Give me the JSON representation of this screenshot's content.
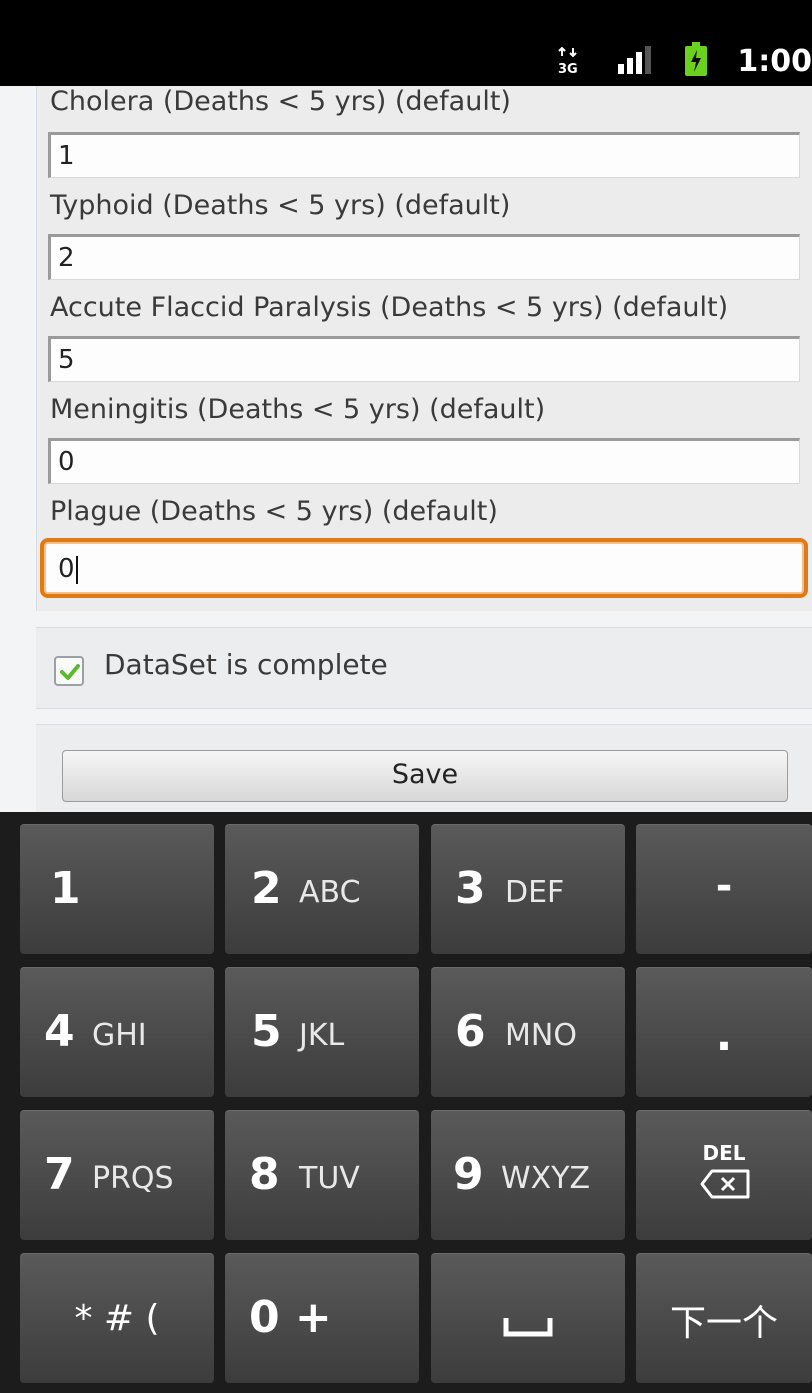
{
  "status_bar": {
    "network_type": "3G",
    "time": "1:00"
  },
  "form": {
    "fields": [
      {
        "label": "Cholera (Deaths < 5 yrs) (default)",
        "value": "1"
      },
      {
        "label": "Typhoid (Deaths < 5 yrs) (default)",
        "value": "2"
      },
      {
        "label": "Accute Flaccid Paralysis (Deaths < 5 yrs) (default)",
        "value": "5"
      },
      {
        "label": "Meningitis (Deaths < 5 yrs) (default)",
        "value": "0"
      },
      {
        "label": "Plague (Deaths < 5 yrs) (default)",
        "value": "0"
      }
    ],
    "complete_label": "DataSet is complete",
    "complete_checked": true,
    "save_label": "Save"
  },
  "keyboard": {
    "keys": [
      {
        "main": "1",
        "sub": ""
      },
      {
        "main": "2",
        "sub": "ABC"
      },
      {
        "main": "3",
        "sub": "DEF"
      },
      {
        "main": "-",
        "sub": ""
      },
      {
        "main": "4",
        "sub": "GHI"
      },
      {
        "main": "5",
        "sub": "JKL"
      },
      {
        "main": "6",
        "sub": "MNO"
      },
      {
        "main": ".",
        "sub": ""
      },
      {
        "main": "7",
        "sub": "PRQS"
      },
      {
        "main": "8",
        "sub": "TUV"
      },
      {
        "main": "9",
        "sub": "WXYZ"
      },
      {
        "main": "DEL",
        "sub": ""
      },
      {
        "main": "* # (",
        "sub": ""
      },
      {
        "main": "0 +",
        "sub": ""
      },
      {
        "main": "",
        "sub": ""
      },
      {
        "main": "下一个",
        "sub": ""
      }
    ]
  },
  "colors": {
    "focus_border": "#e07a14",
    "check_green": "#5cb82e",
    "battery_green": "#6ad21f"
  }
}
